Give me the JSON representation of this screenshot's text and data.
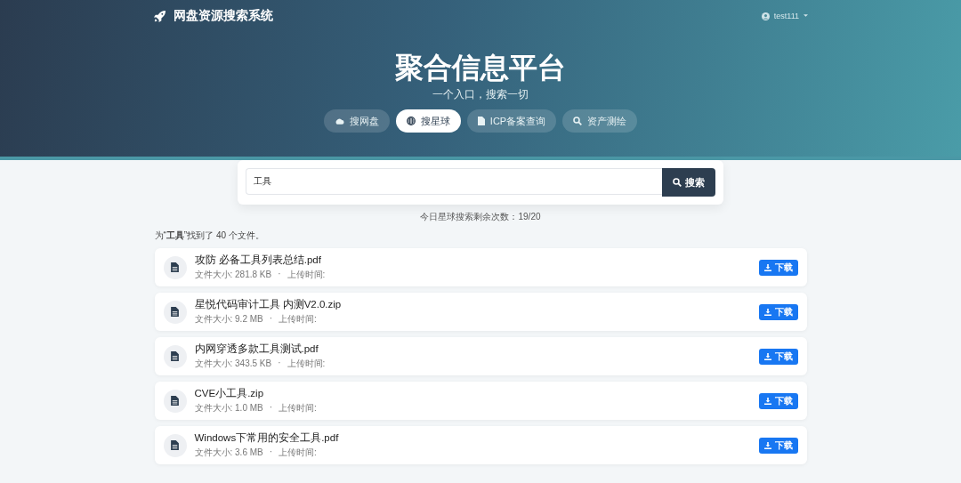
{
  "navbar": {
    "brand": "网盘资源搜索系统",
    "user": "test111"
  },
  "hero": {
    "title": "聚合信息平台",
    "subtitle": "一个入口，搜索一切"
  },
  "tabs": [
    {
      "label": "搜网盘",
      "kind": "cloud",
      "selected": false
    },
    {
      "label": "搜星球",
      "kind": "globe",
      "selected": true
    },
    {
      "label": "ICP备案查询",
      "kind": "document",
      "selected": false
    },
    {
      "label": "资产测绘",
      "kind": "search",
      "selected": false
    }
  ],
  "search": {
    "value": "工具",
    "button": "搜索",
    "quota": "今日星球搜索剩余次数：19/20"
  },
  "result_summary": "为“**工具**”找到了 40 个文件。",
  "files": [
    {
      "name": "攻防 必备工具列表总结.pdf",
      "size": "文件大小: 281.8 KB",
      "separator": "·",
      "upload": "上传时间:",
      "button": "下载"
    },
    {
      "name": "星悦代码审计工具 内测V2.0.zip",
      "size": "文件大小: 9.2 MB",
      "separator": "·",
      "upload": "上传时间:",
      "button": "下载"
    },
    {
      "name": "内网穿透多款工具测试.pdf",
      "size": "文件大小: 343.5 KB",
      "separator": "·",
      "upload": "上传时间:",
      "button": "下载"
    },
    {
      "name": "CVE小工具.zip",
      "size": "文件大小: 1.0 MB",
      "separator": "·",
      "upload": "上传时间:",
      "button": "下载"
    },
    {
      "name": "Windows下常用的安全工具.pdf",
      "size": "文件大小: 3.6 MB",
      "separator": "·",
      "upload": "上传时间:",
      "button": "下载"
    }
  ]
}
